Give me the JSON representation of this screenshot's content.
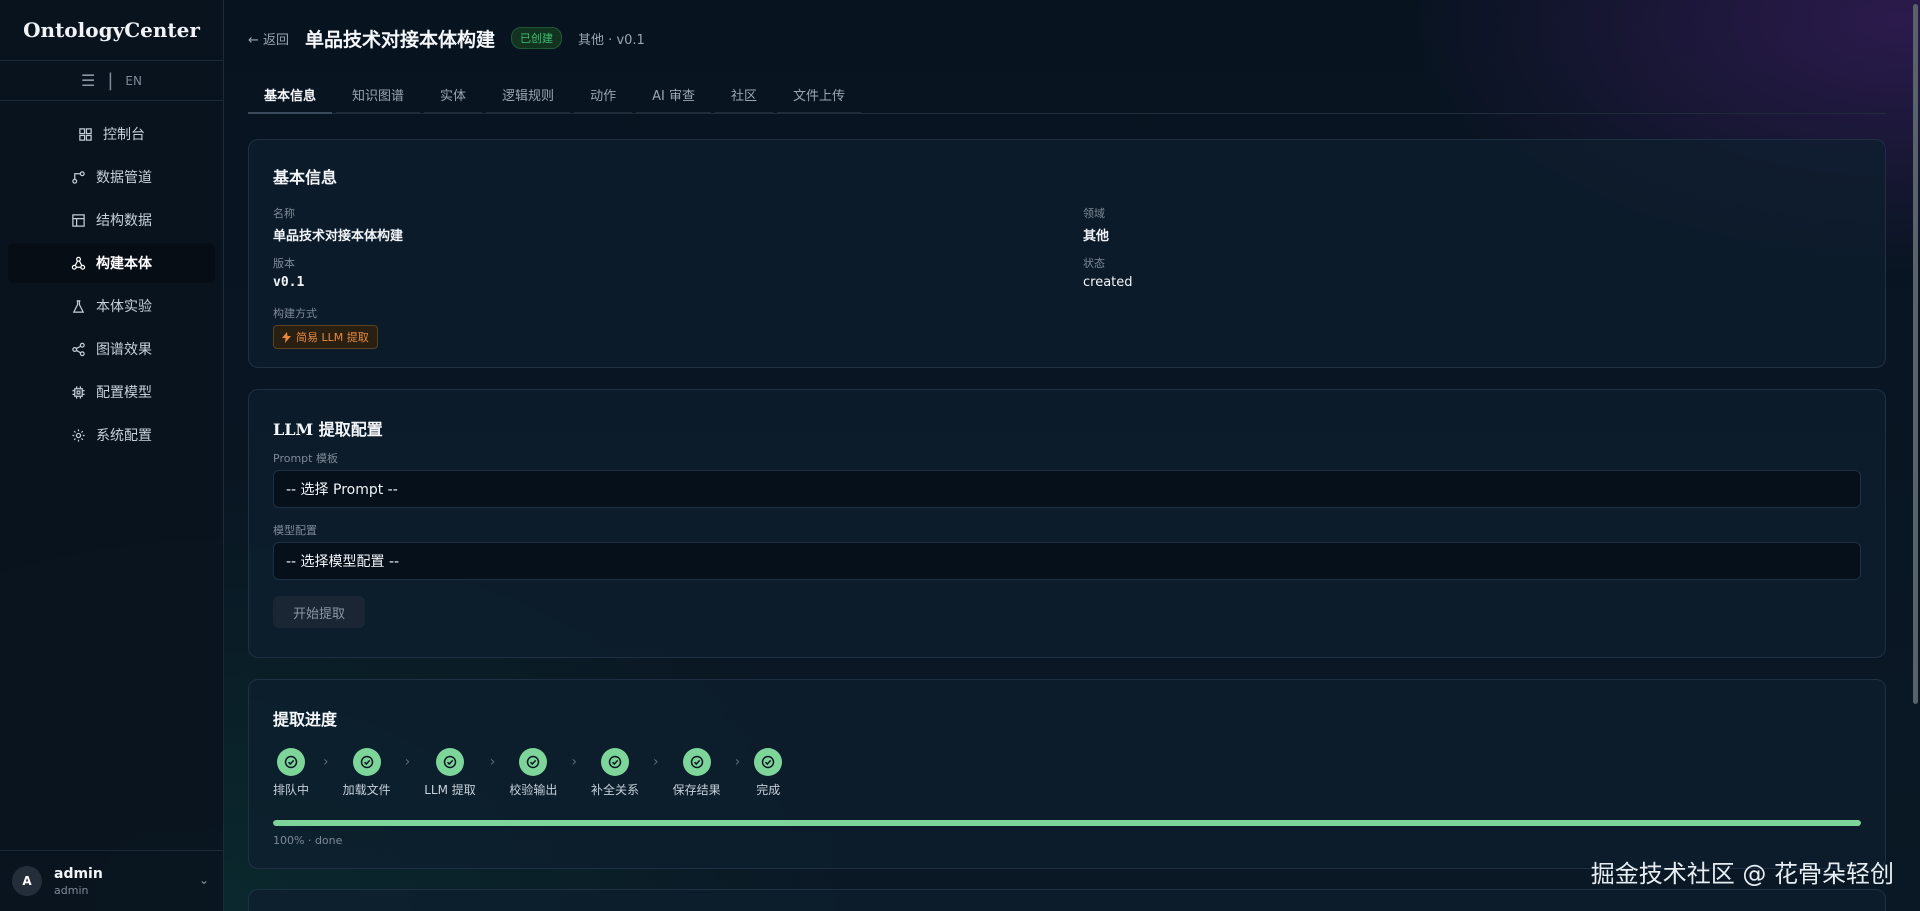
{
  "app": {
    "brand": "OntologyCenter",
    "lang": "EN"
  },
  "sidebar": {
    "items": [
      {
        "label": "控制台",
        "icon": "dashboard-icon"
      },
      {
        "label": "数据管道",
        "icon": "pipeline-icon"
      },
      {
        "label": "结构数据",
        "icon": "table-icon"
      },
      {
        "label": "构建本体",
        "icon": "hierarchy-icon"
      },
      {
        "label": "本体实验",
        "icon": "flask-icon"
      },
      {
        "label": "图谱效果",
        "icon": "share-graph-icon"
      },
      {
        "label": "配置模型",
        "icon": "cpu-icon"
      },
      {
        "label": "系统配置",
        "icon": "gear-icon"
      }
    ],
    "active_index": 3
  },
  "user": {
    "initial": "A",
    "name": "admin",
    "role": "admin"
  },
  "header": {
    "back": "← 返回",
    "title": "单品技术对接本体构建",
    "status": "已创建",
    "meta": "其他 · v0.1"
  },
  "tabs": [
    "基本信息",
    "知识图谱",
    "实体",
    "逻辑规则",
    "动作",
    "AI 审查",
    "社区",
    "文件上传"
  ],
  "basic": {
    "title": "基本信息",
    "name_label": "名称",
    "name_value": "单品技术对接本体构建",
    "domain_label": "领域",
    "domain_value": "其他",
    "version_label": "版本",
    "version_value": "v0.1",
    "state_label": "状态",
    "state_value": "created",
    "method_label": "构建方式",
    "method_value": "简易 LLM 提取"
  },
  "llm": {
    "title": "LLM 提取配置",
    "prompt_label": "Prompt 模板",
    "prompt_value": "-- 选择 Prompt --",
    "model_label": "模型配置",
    "model_value": "-- 选择模型配置 --",
    "start_label": "开始提取"
  },
  "progress": {
    "title": "提取进度",
    "steps": [
      "排队中",
      "加载文件",
      "LLM 提取",
      "校验输出",
      "补全关系",
      "保存结果",
      "完成"
    ],
    "percent": 100,
    "text": "100% · done"
  },
  "watermark": "掘金技术社区 @ 花骨朵轻创",
  "colors": {
    "accent": "#7ed59a",
    "status": "#3cbf73",
    "tag": "#e5893c"
  }
}
